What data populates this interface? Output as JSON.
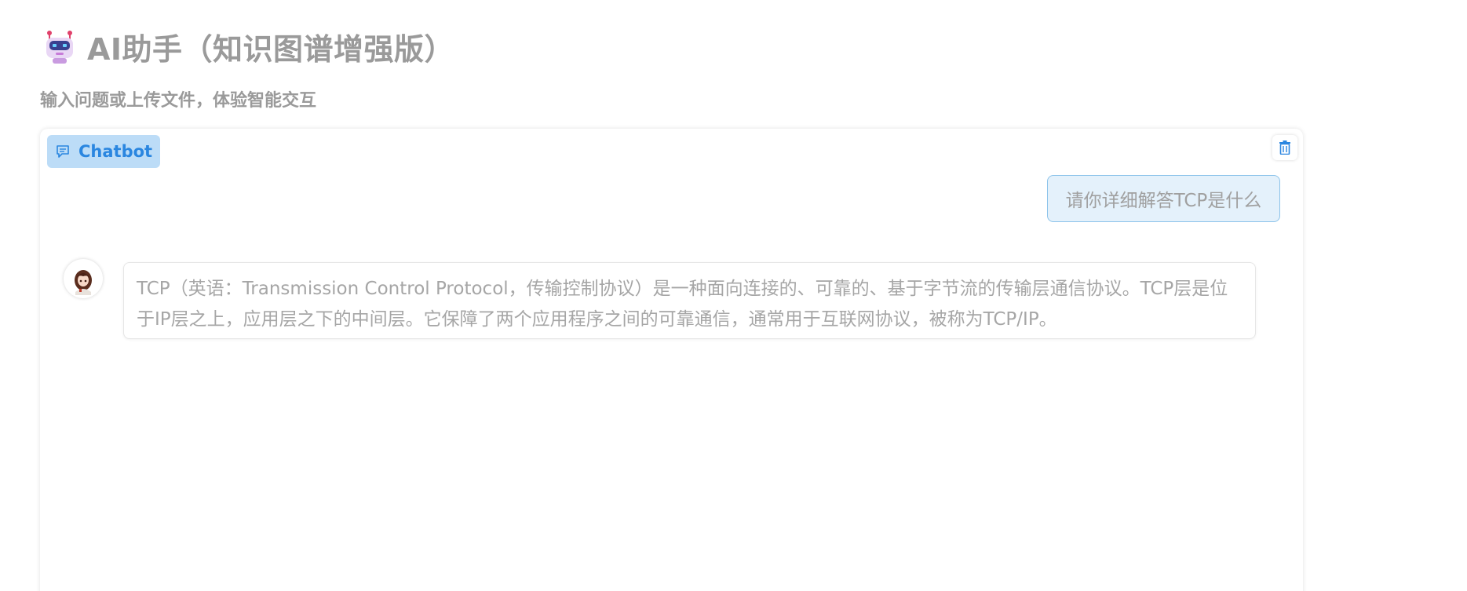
{
  "header": {
    "title": "AI助手（知识图谱增强版）",
    "subtitle": "输入问题或上传文件，体验智能交互",
    "icon": "robot-icon"
  },
  "chatbot": {
    "label": "Chatbot",
    "label_icon": "chat-bubble-icon",
    "clear_icon": "trash-icon",
    "messages": [
      {
        "role": "user",
        "text": "请你详细解答TCP是什么"
      },
      {
        "role": "assistant",
        "avatar": "anime-girl-avatar",
        "text": "TCP（英语：Transmission Control Protocol，传输控制协议）是一种面向连接的、可靠的、基于字节流的传输层通信协议。TCP层是位于IP层之上，应用层之下的中间层。它保障了两个应用程序之间的可靠通信，通常用于互联网协议，被称为TCP/IP。"
      }
    ]
  },
  "colors": {
    "accent": "#2a86e0",
    "label_bg": "#bcdcf7",
    "user_bubble_bg": "#e4f1fb",
    "user_bubble_border": "#8cc3ea",
    "text_muted": "#9a9a9a"
  }
}
